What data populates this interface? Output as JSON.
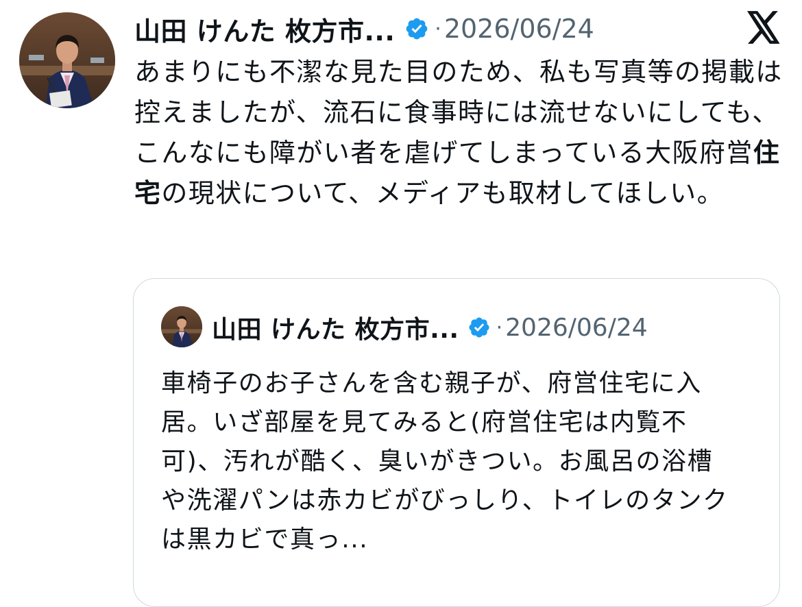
{
  "tweet": {
    "author": {
      "display_name": "山田 けんた 枚方市...",
      "verified": true,
      "avatar_icon": "profile-photo-icon"
    },
    "separator": "·",
    "timestamp": "2026/06/24",
    "text_before_bold": "あまりにも不潔な見た目のため、私も写真等の掲載は控えましたが、流石に食事時には流せないにしても、こんなにも障がい者を虐げてしまっている大阪府営",
    "text_bold": "住宅",
    "text_after_bold": "の現状について、メディアも取材してほしい。"
  },
  "brand": {
    "logo_icon": "x-logo-icon"
  },
  "quoted_tweet": {
    "author": {
      "display_name": "山田 けんた 枚方市...",
      "verified": true,
      "avatar_icon": "profile-photo-icon"
    },
    "separator": "·",
    "timestamp": "2026/06/24",
    "text": "車椅子のお子さんを含む親子が、府営住宅に入居。いざ部屋を見てみると(府営住宅は内覧不可)、汚れが酷く、臭いがきつい。お風呂の浴槽や洗濯パンは赤カビがびっしり、トイレのタンクは黒カビで真っ..."
  },
  "colors": {
    "text_primary": "#0f1419",
    "text_secondary": "#536471",
    "verified_badge": "#1d9bf0",
    "card_border": "#cfd9de",
    "background": "#ffffff"
  }
}
